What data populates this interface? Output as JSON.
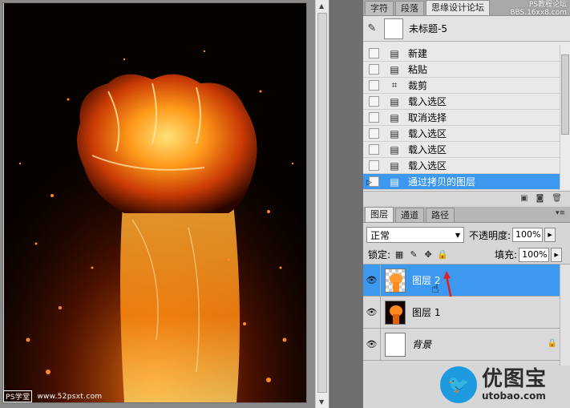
{
  "canvas": {
    "watermark_logo": "PS学堂",
    "watermark_url": "www.52psxt.com"
  },
  "top_tabs": {
    "items": [
      "字符",
      "段落",
      "思缘设计论坛"
    ],
    "active_index": 2,
    "watermark_line1": "PS教程论坛",
    "watermark_line2": "BBS.16xx8.com"
  },
  "history": {
    "snapshot_name": "未标题-5",
    "items": [
      {
        "label": "新建",
        "icon": "new-doc-icon"
      },
      {
        "label": "粘贴",
        "icon": "paste-icon"
      },
      {
        "label": "裁剪",
        "icon": "crop-icon"
      },
      {
        "label": "载入选区",
        "icon": "load-selection-icon"
      },
      {
        "label": "取消选择",
        "icon": "deselect-icon"
      },
      {
        "label": "载入选区",
        "icon": "load-selection-icon"
      },
      {
        "label": "载入选区",
        "icon": "load-selection-icon"
      },
      {
        "label": "载入选区",
        "icon": "load-selection-icon"
      },
      {
        "label": "通过拷贝的图层",
        "icon": "layer-via-copy-icon"
      }
    ],
    "active_index": 8
  },
  "layers_panel": {
    "tabs": [
      "图层",
      "通道",
      "路径"
    ],
    "active_tab": 0,
    "blend_mode": "正常",
    "opacity_label": "不透明度:",
    "opacity_value": "100%",
    "lock_label": "锁定:",
    "fill_label": "填充:",
    "fill_value": "100%",
    "layers": [
      {
        "name": "图层 2",
        "selected": true,
        "thumb": "fist-cutout"
      },
      {
        "name": "图层 1",
        "selected": false,
        "thumb": "fist-dark"
      },
      {
        "name": "背景",
        "selected": false,
        "thumb": "white",
        "locked": true
      }
    ]
  },
  "brand": {
    "name_cn": "优图宝",
    "name_en": "utobao.com"
  },
  "colors": {
    "selection_blue": "#3d98f0",
    "panel_gray": "#d4d4d4",
    "annotation_red": "#e02020",
    "brand_blue": "#1e9be0"
  }
}
